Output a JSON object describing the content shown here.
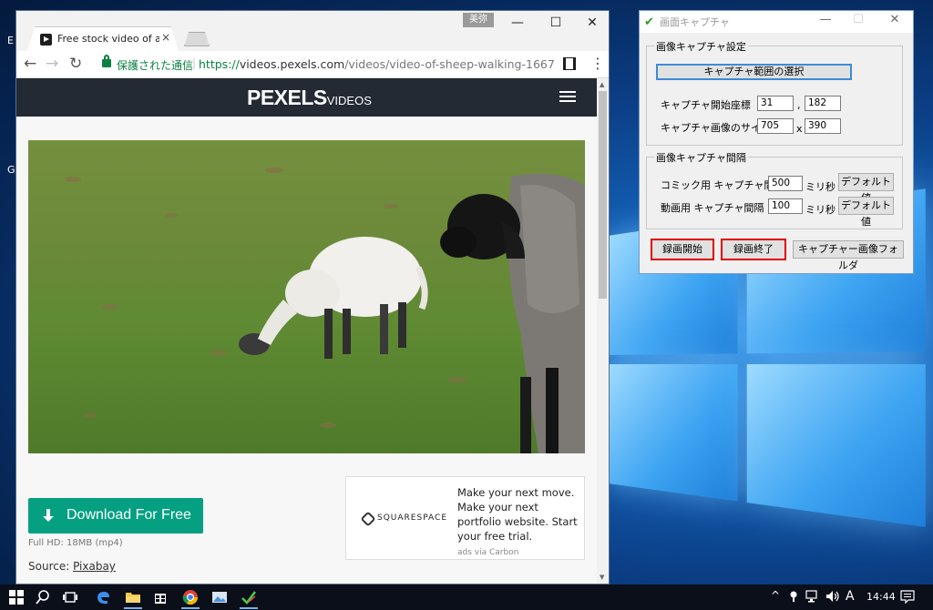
{
  "desktop": {
    "fragment1": "E",
    "fragment2": "G"
  },
  "browser": {
    "tab_title": "Free stock video of anim",
    "tab_close": "×",
    "profile": "美弥",
    "window_controls": {
      "minimize": "—",
      "maximize": "☐",
      "close": "✕"
    },
    "nav": {
      "back": "←",
      "forward": "→",
      "reload": "↻"
    },
    "secure_label": "保護された通信",
    "url_scheme": "https://",
    "url_host": "videos.pexels.com",
    "url_path": "/videos/video-of-sheep-walking-1667",
    "star": "☆",
    "menu": "⋮"
  },
  "page": {
    "logo": "PEXELS",
    "logo_sub": "VIDEOS",
    "download_label": "Download For Free",
    "file_info": "Full HD: 18MB (mp4)",
    "source_prefix": "Source: ",
    "source_link": "Pixabay",
    "ad": {
      "brand": "SQUARESPACE",
      "text": "Make your next move. Make your next portfolio website. Start your free trial.",
      "via": "ads via Carbon"
    }
  },
  "capture_app": {
    "title": "画面キャプチャ",
    "group1_title": "画像キャプチャ設定",
    "select_range": "キャプチャ範囲の選択",
    "start_coord_label": "キャプチャ開始座標",
    "start_x": "31",
    "start_sep": ",",
    "start_y": "182",
    "size_label": "キャプチャ画像のサイズ",
    "width": "705",
    "size_sep": "x",
    "height": "390",
    "group2_title": "画像キャプチャ間隔",
    "comic_label": "コミック用 キャプチャ間隔",
    "comic_value": "500",
    "video_label": "動画用 キャプチャ間隔",
    "video_value": "100",
    "ms_unit": "ミリ秒",
    "default_btn": "デフォルト値",
    "record_start": "録画開始",
    "record_stop": "録画終了",
    "folder_btn": "キャプチャー画像フォルダ"
  },
  "taskbar": {
    "ime": "A",
    "time": "14:44"
  },
  "colors": {
    "pexels_green": "#05a081",
    "pexels_header": "#232a34",
    "record_border": "#e00000"
  }
}
